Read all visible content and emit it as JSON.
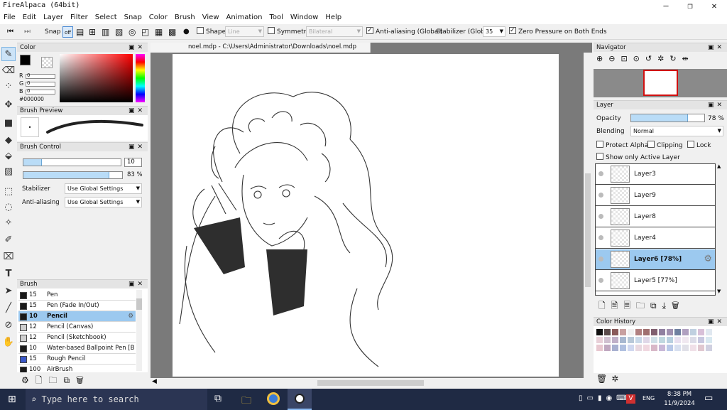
{
  "window": {
    "title": "FireAlpaca (64bit)",
    "minimize": "—",
    "maximize": "❐",
    "close": "✕"
  },
  "menu": [
    "File",
    "Edit",
    "Layer",
    "Filter",
    "Select",
    "Snap",
    "Color",
    "Brush",
    "View",
    "Animation",
    "Tool",
    "Window",
    "Help"
  ],
  "toolbar": {
    "snap_label": "Snap",
    "snap_off": "off",
    "shape_label": "Shape",
    "shape_value": "Line",
    "symmetry_label": "Symmetry",
    "symmetry_value": "Bilateral",
    "antialias_label": "Anti-aliasing (Global)",
    "stabilizer_label": "Stabilizer (Global)",
    "stabilizer_value": "35",
    "zero_pressure_label": "Zero Pressure on Both Ends"
  },
  "color_panel": {
    "title": "Color",
    "r": "R",
    "g": "G",
    "b": "B",
    "r_val": "0",
    "g_val": "0",
    "b_val": "0",
    "hex": "#000000",
    "primary": "#000000"
  },
  "brush_preview": {
    "title": "Brush Preview"
  },
  "brush_control": {
    "title": "Brush Control",
    "size": "10",
    "opacity": "83 %",
    "size_fill": 0.19,
    "opacity_fill": 0.87,
    "stabilizer_label": "Stabilizer",
    "stabilizer_value": "Use Global Settings",
    "antialias_label": "Anti-aliasing",
    "antialias_value": "Use Global Settings"
  },
  "brush_panel": {
    "title": "Brush",
    "items": [
      {
        "size": "15",
        "name": "Pen",
        "color": "#1a1a1a"
      },
      {
        "size": "15",
        "name": "Pen (Fade In/Out)",
        "color": "#1a1a1a"
      },
      {
        "size": "10",
        "name": "Pencil",
        "color": "#1a1a1a"
      },
      {
        "size": "12",
        "name": "Pencil (Canvas)",
        "color": "#cfcfcf"
      },
      {
        "size": "12",
        "name": "Pencil (Sketchbook)",
        "color": "#cfcfcf"
      },
      {
        "size": "10",
        "name": "Water-based Ballpoint Pen [Burn]",
        "color": "#1a1a1a"
      },
      {
        "size": "15",
        "name": "Rough Pencil",
        "color": "#3a58c8"
      },
      {
        "size": "100",
        "name": "AirBrush",
        "color": "#1a1a1a"
      }
    ]
  },
  "document": {
    "tab": "noel.mdp - C:\\Users\\Administrator\\Downloads\\noel.mdp"
  },
  "navigator": {
    "title": "Navigator"
  },
  "layer_panel": {
    "title": "Layer",
    "opacity_label": "Opacity",
    "opacity_value": "78 %",
    "opacity_fill": 0.78,
    "blending_label": "Blending",
    "blending_value": "Normal",
    "protect_alpha": "Protect Alpha",
    "clipping": "Clipping",
    "lock": "Lock",
    "show_only_active": "Show only Active Layer",
    "layers": [
      {
        "name": "Layer3"
      },
      {
        "name": "Layer9"
      },
      {
        "name": "Layer8"
      },
      {
        "name": "Layer4"
      },
      {
        "name": "Layer6 [78%]"
      },
      {
        "name": "Layer5 [77%]"
      }
    ]
  },
  "color_history": {
    "title": "Color History",
    "colors": [
      "#111111",
      "#5a4a4a",
      "#8a5a5a",
      "#c8a0a0",
      "#f0f0f0",
      "#b08080",
      "#a07070",
      "#806070",
      "#9080a0",
      "#a090b0",
      "#7080a0",
      "#b0a0c0",
      "#c0d0e0",
      "#d8c0d8",
      "#e0e8f0",
      "#e8d0d8",
      "#d0c0d0",
      "#c0b0c8",
      "#a8b8d0",
      "#b8c8d8",
      "#c8d8e8",
      "#e0d8e8",
      "#d0e0e8",
      "#c0d8e0",
      "#b8d0e0",
      "#e8e0f0",
      "#f0e8f0",
      "#dcdce8",
      "#c8c8e0",
      "#d8e8f0",
      "#e8c8d0",
      "#c0a8c0",
      "#a8b0d0",
      "#b0c0e0",
      "#d0d8f0",
      "#e8d8e0",
      "#f0d8e0",
      "#d8b8c8",
      "#c8b8d8",
      "#b8c8e8",
      "#d8e0f0",
      "#e0e0e8",
      "#f0e0e8",
      "#e0c8d0",
      "#d0d0e0"
    ]
  },
  "taskbar": {
    "search": "Type here to search",
    "time": "8:38 PM",
    "date": "11/9/2024",
    "lang": "ENG"
  }
}
